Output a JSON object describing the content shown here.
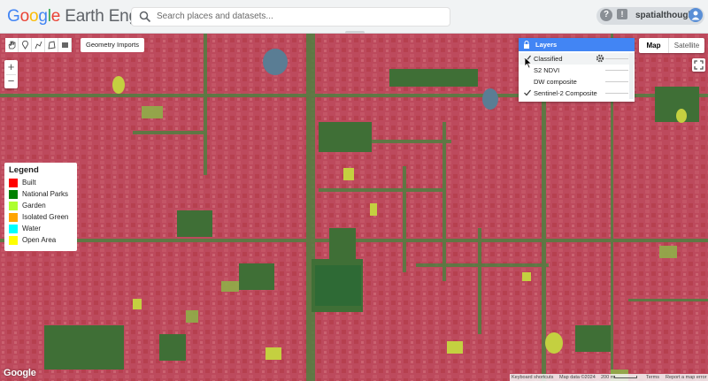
{
  "header": {
    "logo_google": "Google",
    "logo_rest": "Earth Engine",
    "search_placeholder": "Search places and datasets...",
    "username": "spatialthoughts",
    "help_glyph": "?",
    "feedback_glyph": "!"
  },
  "toolbar": {
    "tools": [
      "hand-icon",
      "marker-icon",
      "polyline-icon",
      "polygon-icon",
      "rectangle-icon"
    ],
    "geometry_imports": "Geometry Imports"
  },
  "zoom": {
    "in": "+",
    "out": "−"
  },
  "map_type": {
    "map": "Map",
    "satellite": "Satellite",
    "selected": "Map"
  },
  "layers": {
    "title": "Layers",
    "items": [
      {
        "label": "Classified",
        "checked": true
      },
      {
        "label": "S2 NDVI",
        "checked": false
      },
      {
        "label": "DW composite",
        "checked": false
      },
      {
        "label": "Sentinel-2 Composite",
        "checked": true
      }
    ]
  },
  "legend": {
    "title": "Legend",
    "items": [
      {
        "label": "Built",
        "color": "#ff0000"
      },
      {
        "label": "National Parks",
        "color": "#008000"
      },
      {
        "label": "Garden",
        "color": "#adff2f"
      },
      {
        "label": "Isolated Green",
        "color": "#ffa500"
      },
      {
        "label": "Water",
        "color": "#00ffff"
      },
      {
        "label": "Open Area",
        "color": "#ffff00"
      }
    ]
  },
  "footer": {
    "google": "Google",
    "keyboard_shortcuts": "Keyboard shortcuts",
    "map_data": "Map data ©2024",
    "scale": "200 m",
    "terms": "Terms",
    "report": "Report a map error"
  },
  "colors": {
    "built_overlay": "#bd4a5d",
    "park_overlay": "#3a7a3c",
    "garden_overlay": "#9cc040",
    "open_overlay": "#e0d040",
    "water_overlay": "#5a7d94",
    "layers_header": "#4285f4"
  }
}
